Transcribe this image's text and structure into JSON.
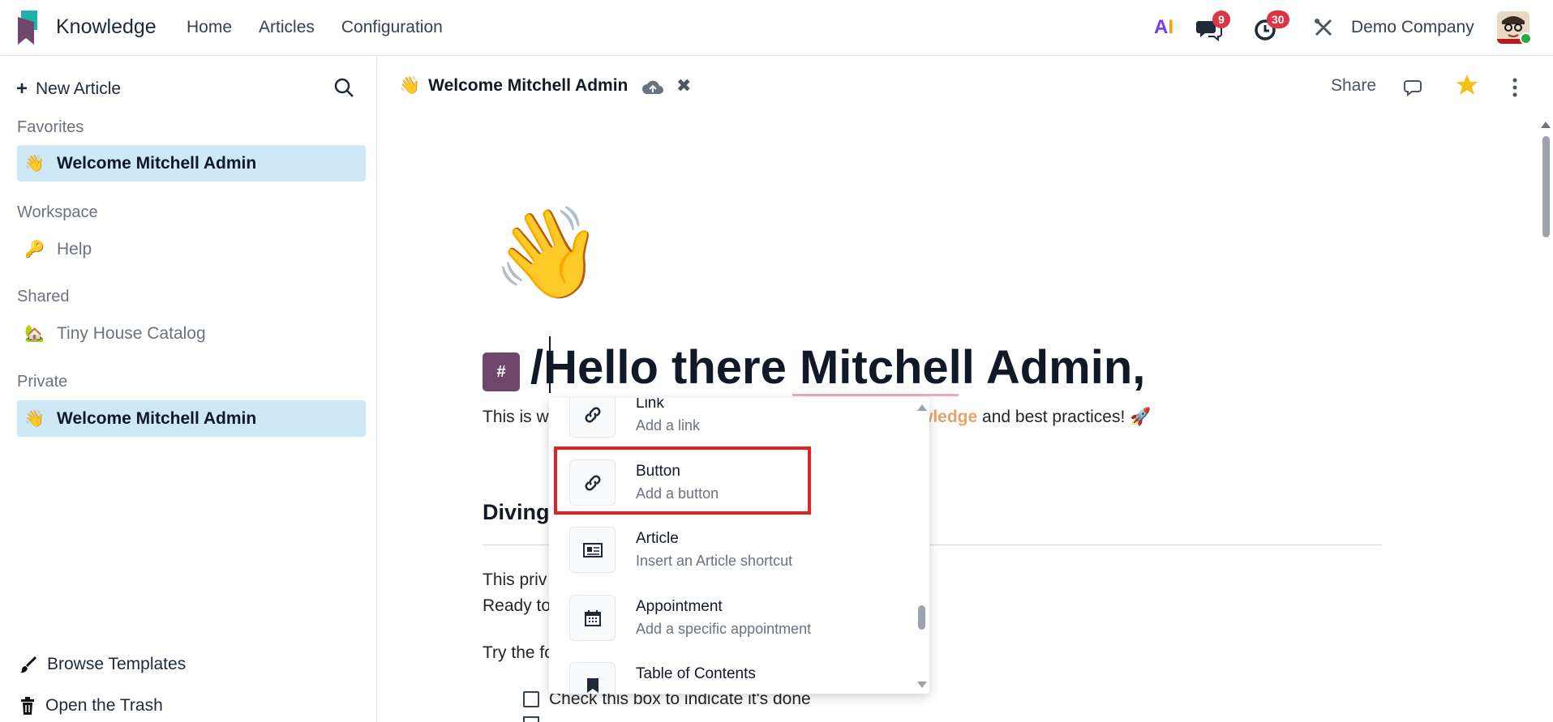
{
  "navbar": {
    "app_name": "Knowledge",
    "menu": [
      "Home",
      "Articles",
      "Configuration"
    ],
    "ai_label_a": "A",
    "ai_label_i": "I",
    "chat_badge": "9",
    "activity_badge": "30",
    "company": "Demo Company",
    "colors": {
      "badge": "#dc3545",
      "logo_teal": "#20b2aa",
      "logo_purple": "#71466b"
    }
  },
  "sidebar": {
    "new_article": "New Article",
    "sections": {
      "favorites": {
        "title": "Favorites",
        "items": [
          {
            "emoji": "👋",
            "label": "Welcome Mitchell Admin"
          }
        ]
      },
      "workspace": {
        "title": "Workspace",
        "items": [
          {
            "emoji": "🔑",
            "label": "Help"
          }
        ]
      },
      "shared": {
        "title": "Shared",
        "items": [
          {
            "emoji": "🏡",
            "label": "Tiny House Catalog"
          }
        ]
      },
      "private": {
        "title": "Private",
        "items": [
          {
            "emoji": "👋",
            "label": "Welcome Mitchell Admin"
          }
        ]
      }
    },
    "browse_templates": "Browse Templates",
    "open_trash": "Open the Trash",
    "active_color": "#cfe8f5"
  },
  "header": {
    "emoji": "👋",
    "title": "Welcome Mitchell Admin",
    "share": "Share"
  },
  "article": {
    "cover_emoji": "👋",
    "hash": "#",
    "title": "/Hello there Mitchell Admin,",
    "intro_left": "This is w",
    "intro_keyword": "wledge",
    "intro_right": " and best practices! 🚀",
    "heading_diving": "Diving",
    "para1": "This priv",
    "para2": "Ready to",
    "para3": "Try the fo",
    "checklist_item": "Check this box to indicate it's done"
  },
  "command_menu": {
    "items": [
      {
        "title": "Link",
        "desc": "Add a link",
        "icon": "link-icon"
      },
      {
        "title": "Button",
        "desc": "Add a button",
        "icon": "link-icon"
      },
      {
        "title": "Article",
        "desc": "Insert an Article shortcut",
        "icon": "newspaper-icon"
      },
      {
        "title": "Appointment",
        "desc": "Add a specific appointment",
        "icon": "calendar-icon"
      },
      {
        "title": "Table of Contents",
        "desc": "",
        "icon": "bookmark-icon"
      }
    ],
    "highlight_color": "#dc2626"
  }
}
